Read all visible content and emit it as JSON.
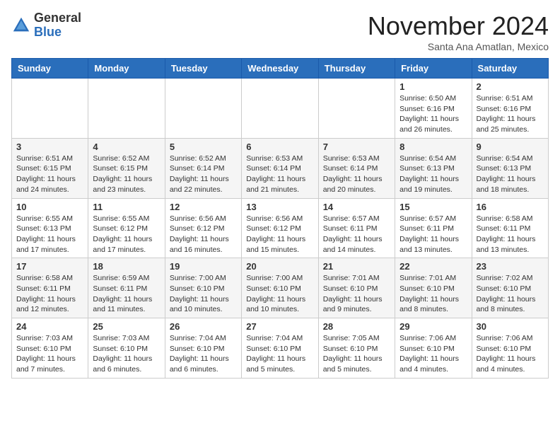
{
  "header": {
    "logo_general": "General",
    "logo_blue": "Blue",
    "month_title": "November 2024",
    "location": "Santa Ana Amatlan, Mexico"
  },
  "weekdays": [
    "Sunday",
    "Monday",
    "Tuesday",
    "Wednesday",
    "Thursday",
    "Friday",
    "Saturday"
  ],
  "weeks": [
    [
      {
        "day": "",
        "info": ""
      },
      {
        "day": "",
        "info": ""
      },
      {
        "day": "",
        "info": ""
      },
      {
        "day": "",
        "info": ""
      },
      {
        "day": "",
        "info": ""
      },
      {
        "day": "1",
        "info": "Sunrise: 6:50 AM\nSunset: 6:16 PM\nDaylight: 11 hours and 26 minutes."
      },
      {
        "day": "2",
        "info": "Sunrise: 6:51 AM\nSunset: 6:16 PM\nDaylight: 11 hours and 25 minutes."
      }
    ],
    [
      {
        "day": "3",
        "info": "Sunrise: 6:51 AM\nSunset: 6:15 PM\nDaylight: 11 hours and 24 minutes."
      },
      {
        "day": "4",
        "info": "Sunrise: 6:52 AM\nSunset: 6:15 PM\nDaylight: 11 hours and 23 minutes."
      },
      {
        "day": "5",
        "info": "Sunrise: 6:52 AM\nSunset: 6:14 PM\nDaylight: 11 hours and 22 minutes."
      },
      {
        "day": "6",
        "info": "Sunrise: 6:53 AM\nSunset: 6:14 PM\nDaylight: 11 hours and 21 minutes."
      },
      {
        "day": "7",
        "info": "Sunrise: 6:53 AM\nSunset: 6:14 PM\nDaylight: 11 hours and 20 minutes."
      },
      {
        "day": "8",
        "info": "Sunrise: 6:54 AM\nSunset: 6:13 PM\nDaylight: 11 hours and 19 minutes."
      },
      {
        "day": "9",
        "info": "Sunrise: 6:54 AM\nSunset: 6:13 PM\nDaylight: 11 hours and 18 minutes."
      }
    ],
    [
      {
        "day": "10",
        "info": "Sunrise: 6:55 AM\nSunset: 6:13 PM\nDaylight: 11 hours and 17 minutes."
      },
      {
        "day": "11",
        "info": "Sunrise: 6:55 AM\nSunset: 6:12 PM\nDaylight: 11 hours and 17 minutes."
      },
      {
        "day": "12",
        "info": "Sunrise: 6:56 AM\nSunset: 6:12 PM\nDaylight: 11 hours and 16 minutes."
      },
      {
        "day": "13",
        "info": "Sunrise: 6:56 AM\nSunset: 6:12 PM\nDaylight: 11 hours and 15 minutes."
      },
      {
        "day": "14",
        "info": "Sunrise: 6:57 AM\nSunset: 6:11 PM\nDaylight: 11 hours and 14 minutes."
      },
      {
        "day": "15",
        "info": "Sunrise: 6:57 AM\nSunset: 6:11 PM\nDaylight: 11 hours and 13 minutes."
      },
      {
        "day": "16",
        "info": "Sunrise: 6:58 AM\nSunset: 6:11 PM\nDaylight: 11 hours and 13 minutes."
      }
    ],
    [
      {
        "day": "17",
        "info": "Sunrise: 6:58 AM\nSunset: 6:11 PM\nDaylight: 11 hours and 12 minutes."
      },
      {
        "day": "18",
        "info": "Sunrise: 6:59 AM\nSunset: 6:11 PM\nDaylight: 11 hours and 11 minutes."
      },
      {
        "day": "19",
        "info": "Sunrise: 7:00 AM\nSunset: 6:10 PM\nDaylight: 11 hours and 10 minutes."
      },
      {
        "day": "20",
        "info": "Sunrise: 7:00 AM\nSunset: 6:10 PM\nDaylight: 11 hours and 10 minutes."
      },
      {
        "day": "21",
        "info": "Sunrise: 7:01 AM\nSunset: 6:10 PM\nDaylight: 11 hours and 9 minutes."
      },
      {
        "day": "22",
        "info": "Sunrise: 7:01 AM\nSunset: 6:10 PM\nDaylight: 11 hours and 8 minutes."
      },
      {
        "day": "23",
        "info": "Sunrise: 7:02 AM\nSunset: 6:10 PM\nDaylight: 11 hours and 8 minutes."
      }
    ],
    [
      {
        "day": "24",
        "info": "Sunrise: 7:03 AM\nSunset: 6:10 PM\nDaylight: 11 hours and 7 minutes."
      },
      {
        "day": "25",
        "info": "Sunrise: 7:03 AM\nSunset: 6:10 PM\nDaylight: 11 hours and 6 minutes."
      },
      {
        "day": "26",
        "info": "Sunrise: 7:04 AM\nSunset: 6:10 PM\nDaylight: 11 hours and 6 minutes."
      },
      {
        "day": "27",
        "info": "Sunrise: 7:04 AM\nSunset: 6:10 PM\nDaylight: 11 hours and 5 minutes."
      },
      {
        "day": "28",
        "info": "Sunrise: 7:05 AM\nSunset: 6:10 PM\nDaylight: 11 hours and 5 minutes."
      },
      {
        "day": "29",
        "info": "Sunrise: 7:06 AM\nSunset: 6:10 PM\nDaylight: 11 hours and 4 minutes."
      },
      {
        "day": "30",
        "info": "Sunrise: 7:06 AM\nSunset: 6:10 PM\nDaylight: 11 hours and 4 minutes."
      }
    ]
  ]
}
